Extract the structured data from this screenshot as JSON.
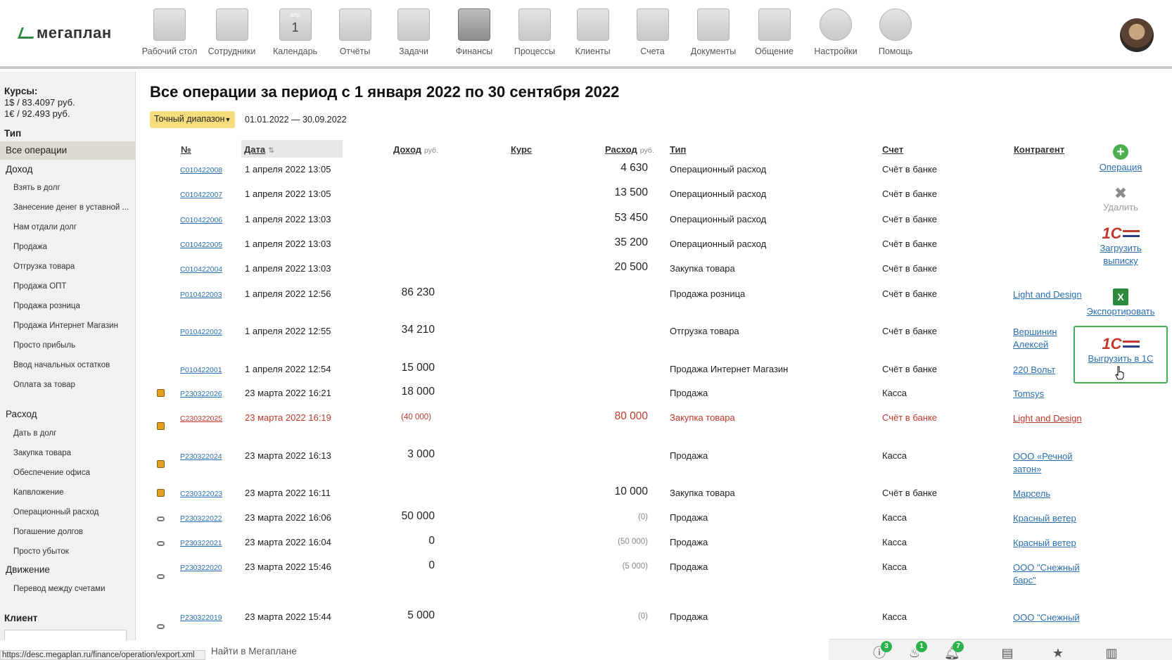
{
  "app": {
    "logo": "мегаплан"
  },
  "nav": [
    {
      "label": "Рабочий стол",
      "icon": "desktop-icon"
    },
    {
      "label": "Сотрудники",
      "icon": "employees-icon"
    },
    {
      "label": "Календарь",
      "icon": "calendar-icon",
      "cal_month": "апр",
      "cal_day": "1"
    },
    {
      "label": "Отчёты",
      "icon": "reports-icon"
    },
    {
      "label": "Задачи",
      "icon": "tasks-icon"
    },
    {
      "label": "Финансы",
      "icon": "safe-icon",
      "active": true
    },
    {
      "label": "Процессы",
      "icon": "processes-icon"
    },
    {
      "label": "Клиенты",
      "icon": "clients-icon"
    },
    {
      "label": "Счета",
      "icon": "invoices-icon"
    },
    {
      "label": "Документы",
      "icon": "folder-icon"
    },
    {
      "label": "Общение",
      "icon": "chat-icon"
    },
    {
      "label": "Настройки",
      "icon": "gear-icon"
    },
    {
      "label": "Помощь",
      "icon": "lifebuoy-icon"
    }
  ],
  "sidebar": {
    "rates_title": "Курсы:",
    "rate_usd": "1$ / 83.4097 руб.",
    "rate_eur": "1€ / 92.493 руб.",
    "type_title": "Тип",
    "all_ops": "Все операции",
    "income": "Доход",
    "income_items": [
      "Взять в долг",
      "Занесение денег в уставной ...",
      "Нам отдали долг",
      "Продажа",
      "Отгрузка товара",
      "Продажа ОПТ",
      "Продажа розница",
      "Продажа Интернет Магазин",
      "Просто прибыль",
      "Ввод начальных остатков",
      "Оплата за товар"
    ],
    "expense": "Расход",
    "expense_items": [
      "Дать в долг",
      "Закупка товара",
      "Обеспечение офиса",
      "Капвложение",
      "Операционный расход",
      "Погашение долгов",
      "Просто убыток"
    ],
    "movement": "Движение",
    "movement_items": [
      "Перевод между счетами"
    ],
    "client_title": "Клиент"
  },
  "main": {
    "title": "Все операции за период с 1 января 2022 по 30 сентября 2022",
    "range_button": "Точный диапазон",
    "range_value": "01.01.2022 — 30.09.2022",
    "columns": {
      "num": "№",
      "date": "Дата",
      "income": "Доход",
      "income_unit": "руб.",
      "rate": "Курс",
      "expense": "Расход",
      "expense_unit": "руб.",
      "type": "Тип",
      "account": "Счет",
      "counterparty": "Контрагент"
    }
  },
  "rows": [
    {
      "icon": "",
      "num": "C010422008",
      "date": "1 апреля 2022 13:05",
      "income": "",
      "expense": "4 630",
      "type": "Операционный расход",
      "account": "Счёт в банке",
      "counterparty": ""
    },
    {
      "icon": "",
      "num": "C010422007",
      "date": "1 апреля 2022 13:05",
      "income": "",
      "expense": "13 500",
      "type": "Операционный расход",
      "account": "Счёт в банке",
      "counterparty": ""
    },
    {
      "icon": "",
      "num": "C010422006",
      "date": "1 апреля 2022 13:03",
      "income": "",
      "expense": "53 450",
      "type": "Операционный расход",
      "account": "Счёт в банке",
      "counterparty": ""
    },
    {
      "icon": "",
      "num": "C010422005",
      "date": "1 апреля 2022 13:03",
      "income": "",
      "expense": "35 200",
      "type": "Операционный расход",
      "account": "Счёт в банке",
      "counterparty": ""
    },
    {
      "icon": "",
      "num": "C010422004",
      "date": "1 апреля 2022 13:03",
      "income": "",
      "expense": "20 500",
      "type": "Закупка товара",
      "account": "Счёт в банке",
      "counterparty": ""
    },
    {
      "icon": "",
      "num": "P010422003",
      "date": "1 апреля 2022 12:56",
      "income": "86 230",
      "expense": "",
      "type": "Продажа розница",
      "account": "Счёт в банке",
      "counterparty": "Light and Design"
    },
    {
      "icon": "",
      "num": "P010422002",
      "date": "1 апреля 2022 12:55",
      "income": "34 210",
      "expense": "",
      "type": "Отгрузка товара",
      "account": "Счёт в банке",
      "counterparty": "Вершинин Алексей"
    },
    {
      "icon": "",
      "num": "P010422001",
      "date": "1 апреля 2022 12:54",
      "income": "15 000",
      "expense": "",
      "type": "Продажа Интернет Магазин",
      "account": "Счёт в банке",
      "counterparty": "220 Вольт"
    },
    {
      "icon": "bag",
      "num": "P230322026",
      "date": "23 марта 2022 16:21",
      "income": "18 000",
      "expense": "",
      "type": "Продажа",
      "account": "Касса",
      "counterparty": "Tomsys"
    },
    {
      "icon": "bag",
      "num": "C230322025",
      "date": "23 марта 2022 16:19",
      "income": "(40 000)",
      "expense": "80 000",
      "type": "Закупка товара",
      "account": "Счёт в банке",
      "counterparty": "Light and Design",
      "red": true
    },
    {
      "icon": "bag",
      "num": "P230322024",
      "date": "23 марта 2022 16:13",
      "income": "3 000",
      "expense": "",
      "type": "Продажа",
      "account": "Касса",
      "counterparty": "ООО «Речной затон»"
    },
    {
      "icon": "bag",
      "num": "C230322023",
      "date": "23 марта 2022 16:11",
      "income": "",
      "expense": "10 000",
      "type": "Закупка товара",
      "account": "Счёт в банке",
      "counterparty": "Марсель"
    },
    {
      "icon": "link",
      "num": "P230322022",
      "date": "23 марта 2022 16:06",
      "income": "50 000",
      "expense": "(0)",
      "type": "Продажа",
      "account": "Касса",
      "counterparty": "Красный ветер"
    },
    {
      "icon": "link",
      "num": "P230322021",
      "date": "23 марта 2022 16:04",
      "income": "0",
      "expense": "(50 000)",
      "type": "Продажа",
      "account": "Касса",
      "counterparty": "Красный ветер"
    },
    {
      "icon": "link",
      "num": "P230322020",
      "date": "23 марта 2022 15:46",
      "income": "0",
      "expense": "(5 000)",
      "type": "Продажа",
      "account": "Касса",
      "counterparty": "ООО \"Снежный барс\""
    },
    {
      "icon": "link",
      "num": "P230322019",
      "date": "23 марта 2022 15:44",
      "income": "5 000",
      "expense": "(0)",
      "type": "Продажа",
      "account": "Касса",
      "counterparty": "ООО \"Снежный"
    }
  ],
  "actions": {
    "operation": "Операция",
    "delete": "Удалить",
    "load_statement": "Загрузить выписку",
    "export": "Экспортировать",
    "upload_1c": "Выгрузить в 1С",
    "onec_logo": "1С"
  },
  "footer": {
    "status_url": "https://desc.megaplan.ru/finance/operation/export.xml",
    "search_placeholder": "Найти в Мегаплане",
    "badges": {
      "alerts": "3",
      "fire": "1",
      "notifications": "7"
    }
  }
}
